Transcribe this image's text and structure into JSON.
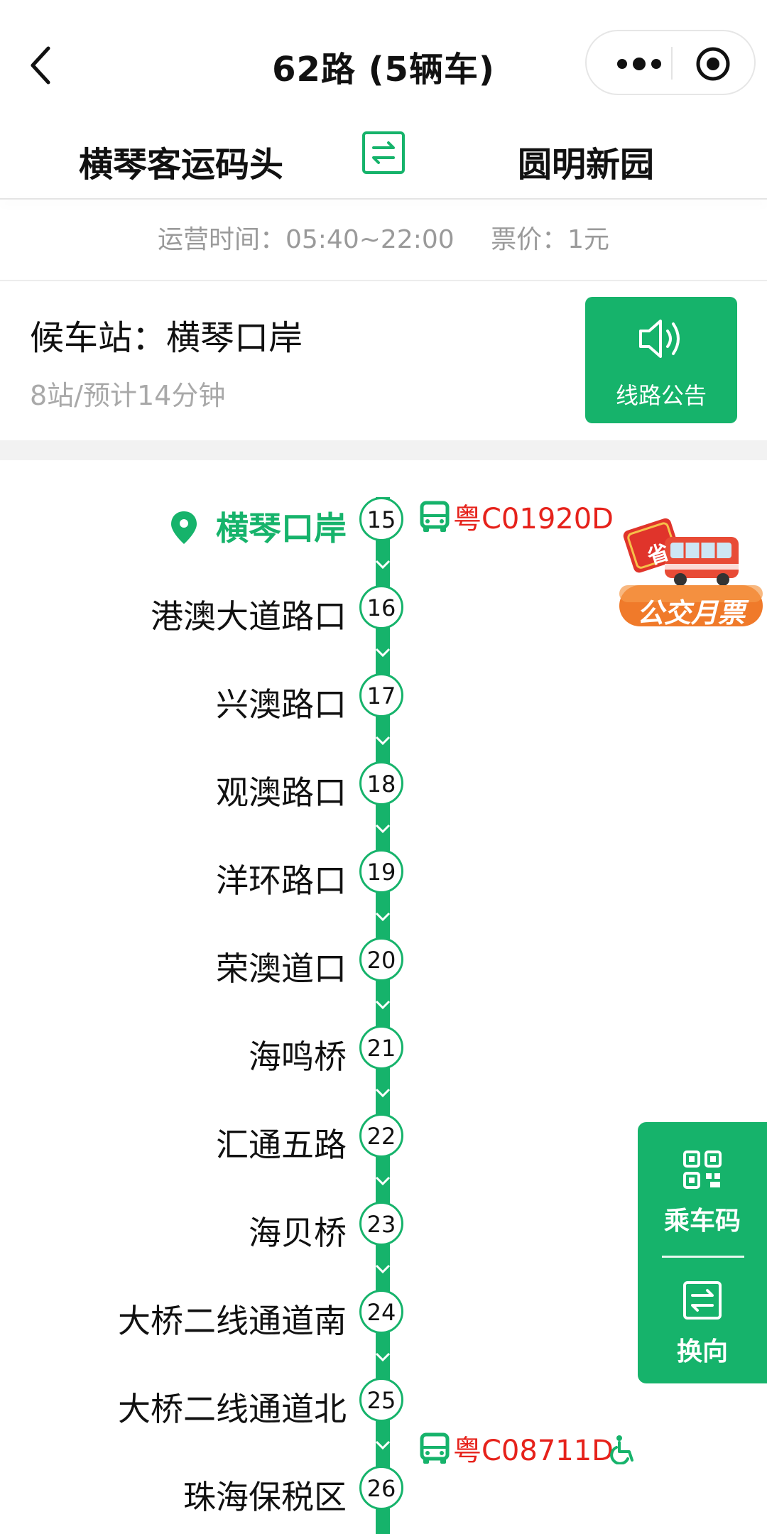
{
  "header": {
    "title": "62路 (5辆车)"
  },
  "direction": {
    "from": "横琴客运码头",
    "to": "圆明新园"
  },
  "info": {
    "hours": "运营时间：05:40~22:00",
    "fare": "票价：1元"
  },
  "wait_station": {
    "name": "候车站：横琴口岸",
    "eta": "8站/预计14分钟",
    "notice_label": "线路公告"
  },
  "stops": [
    {
      "name": "横琴口岸",
      "num": "15",
      "current": true
    },
    {
      "name": "港澳大道路口",
      "num": "16"
    },
    {
      "name": "兴澳路口",
      "num": "17"
    },
    {
      "name": "观澳路口",
      "num": "18"
    },
    {
      "name": "洋环路口",
      "num": "19"
    },
    {
      "name": "荣澳道口",
      "num": "20"
    },
    {
      "name": "海鸣桥",
      "num": "21"
    },
    {
      "name": "汇通五路",
      "num": "22"
    },
    {
      "name": "海贝桥",
      "num": "23"
    },
    {
      "name": "大桥二线通道南",
      "num": "24"
    },
    {
      "name": "大桥二线通道北",
      "num": "25"
    },
    {
      "name": "珠海保税区",
      "num": "26"
    }
  ],
  "buses": [
    {
      "plate": "粤C01920D",
      "wheelchair": false
    },
    {
      "plate": "粤C08711D",
      "wheelchair": true
    }
  ],
  "promo": {
    "badge": "省",
    "label": "公交月票"
  },
  "float_panel": {
    "ride_code": "乘车码",
    "switch": "换向"
  },
  "colors": {
    "accent": "#16b36b",
    "plate": "#e6221b",
    "promo_orange": "#f07a2a"
  },
  "icons": [
    "back-arrow-icon",
    "more-dots-icon",
    "record-icon",
    "swap-icon",
    "speaker-icon",
    "location-pin-icon",
    "bus-icon",
    "wheelchair-icon",
    "qr-code-icon",
    "switch-direction-icon"
  ]
}
